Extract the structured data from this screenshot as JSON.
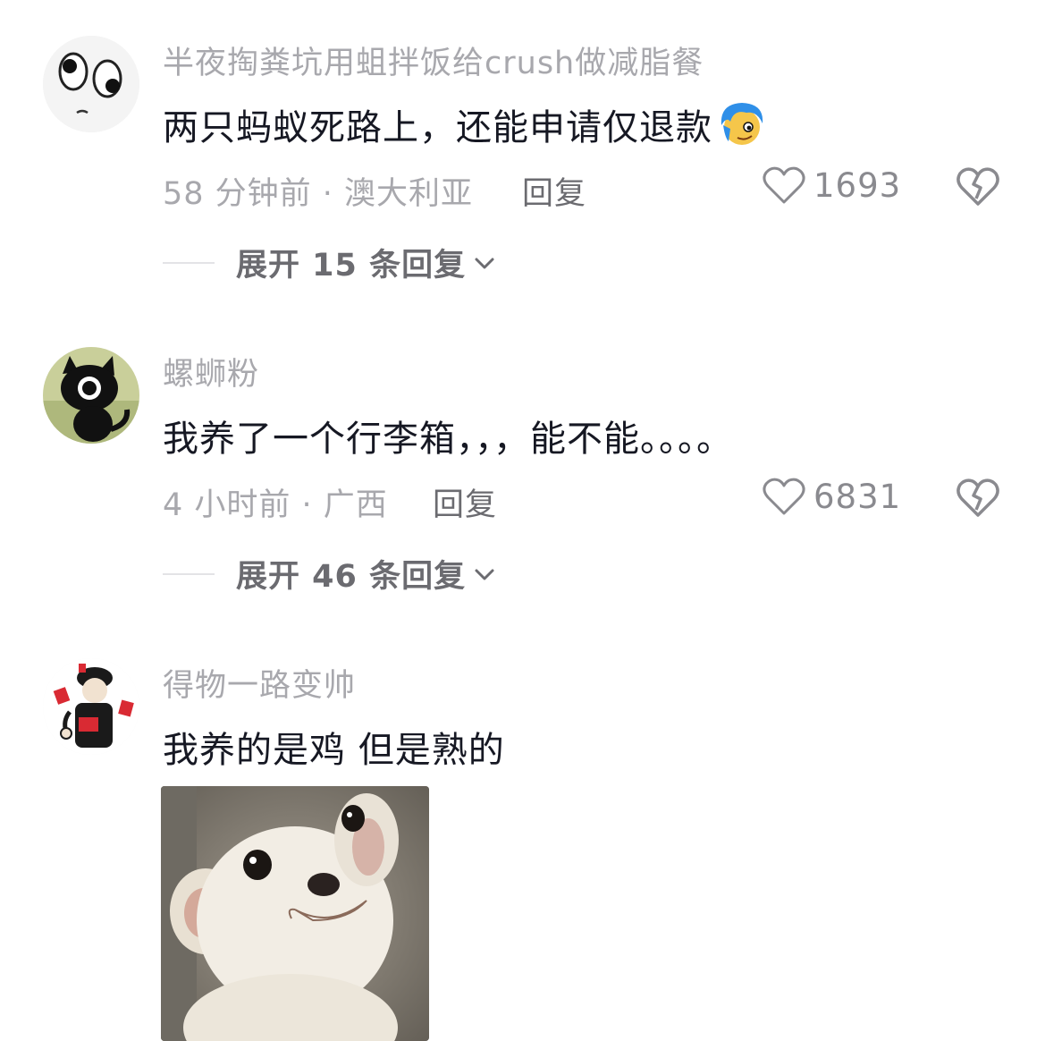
{
  "comments": [
    {
      "username": "半夜掏粪坑用蛆拌饭给crush做减脂餐",
      "content": "两只蚂蚁死路上，还能申请仅退款",
      "emoji": "blue-hair-emoji",
      "time_location": "58 分钟前 · 澳大利亚",
      "reply_label": "回复",
      "likes": "1693",
      "expand_label": "展开 15 条回复"
    },
    {
      "username": "螺蛳粉",
      "content": "我养了一个行李箱，，，能不能。。。。",
      "time_location": "4 小时前 · 广西",
      "reply_label": "回复",
      "likes": "6831",
      "expand_label": "展开 46 条回复"
    },
    {
      "username": "得物一路变帅",
      "content": "我养的是鸡 但是熟的",
      "image": "chihuahua-sticker"
    }
  ],
  "icons": {
    "like": "heart-outline-icon",
    "dislike": "broken-heart-icon",
    "expand": "chevron-down-icon"
  },
  "colors": {
    "text_primary": "#161823",
    "text_secondary": "#a8a8ad",
    "action": "#6b6b70"
  }
}
